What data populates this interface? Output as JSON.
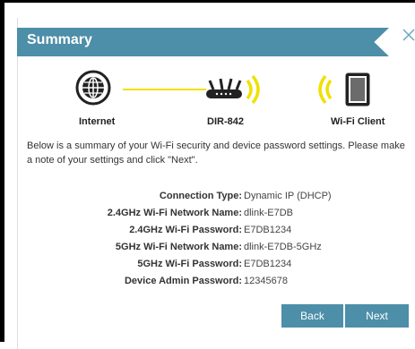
{
  "dialog": {
    "title": "Summary"
  },
  "diagram": {
    "internet_label": "Internet",
    "router_label": "DIR-842",
    "client_label": "Wi-Fi Client"
  },
  "intro": {
    "text": "Below is a summary of your Wi-Fi security and device password settings. Please make a note of your settings and click \"Next\"."
  },
  "settings": [
    {
      "label": "Connection Type:",
      "value": "Dynamic IP (DHCP)"
    },
    {
      "label": "2.4GHz Wi-Fi Network Name:",
      "value": "dlink-E7DB"
    },
    {
      "label": "2.4GHz Wi-Fi Password:",
      "value": "E7DB1234"
    },
    {
      "label": "5GHz Wi-Fi Network Name:",
      "value": "dlink-E7DB-5GHz"
    },
    {
      "label": "5GHz Wi-Fi Password:",
      "value": "E7DB1234"
    },
    {
      "label": "Device Admin Password:",
      "value": "12345678"
    }
  ],
  "buttons": {
    "back": "Back",
    "next": "Next"
  },
  "colors": {
    "header": "#4d8ea8",
    "accent_line": "#f0e000",
    "wifi_waves": "#f0e000"
  },
  "icons": {
    "internet": "globe-icon",
    "router": "router-icon",
    "client": "tablet-icon",
    "close": "close-icon"
  }
}
